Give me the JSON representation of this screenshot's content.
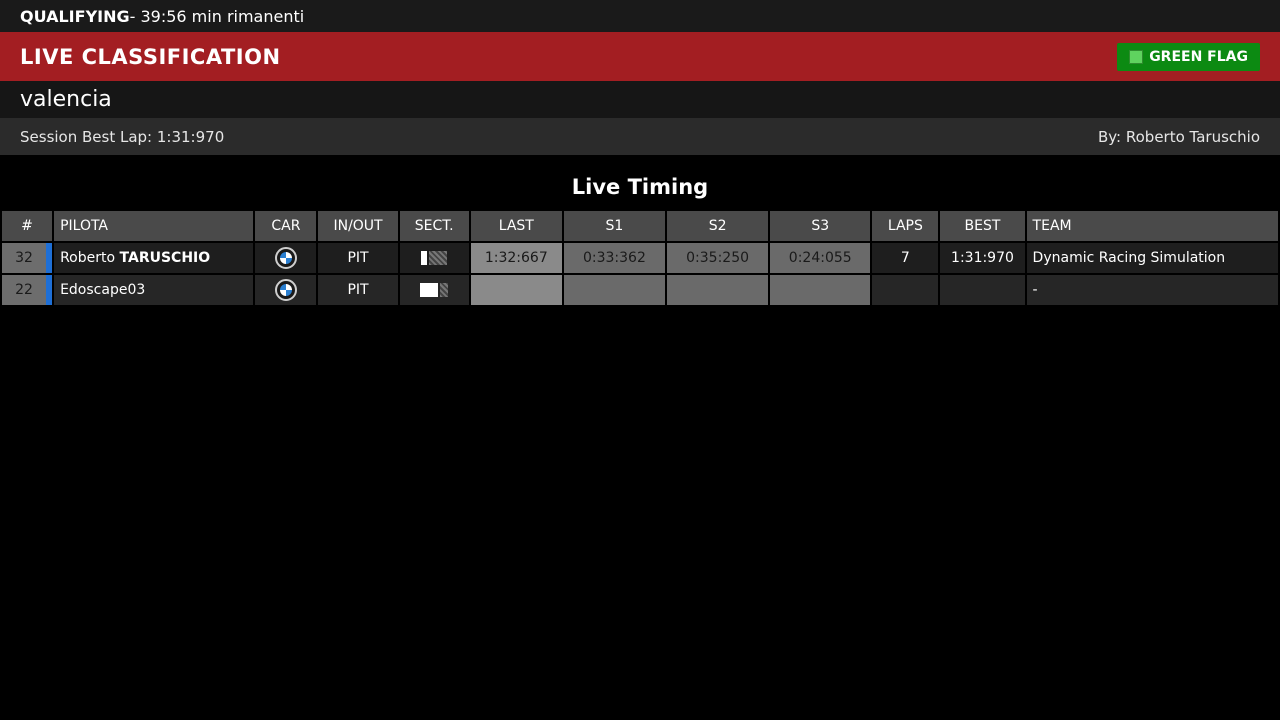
{
  "session": {
    "type": "QUALIFYING",
    "remaining": " - 39:56 min rimanenti"
  },
  "banner": {
    "title": "LIVE CLASSIFICATION",
    "flag_label": "GREEN FLAG",
    "flag_color": "#0c8a12"
  },
  "track": "valencia",
  "best": {
    "lap_text": "Session Best Lap: 1:31:970",
    "by_text": "By: Roberto Taruschio"
  },
  "section_title": "Live Timing",
  "table": {
    "headers": [
      "#",
      "PILOTA",
      "CAR",
      "IN/OUT",
      "SECT.",
      "LAST",
      "S1",
      "S2",
      "S3",
      "LAPS",
      "BEST",
      "TEAM"
    ],
    "rows": [
      {
        "num": "32",
        "first_name": "Roberto ",
        "last_name": "TARUSCHIO",
        "car_icon": "bmw-logo-icon",
        "inout": "PIT",
        "last": "1:32:667",
        "s1": "0:33:362",
        "s2": "0:35:250",
        "s3": "0:24:055",
        "laps": "7",
        "best": "1:31:970",
        "team": "Dynamic Racing Simulation"
      },
      {
        "num": "22",
        "first_name": "Edoscape03",
        "last_name": "",
        "car_icon": "bmw-logo-icon",
        "inout": "PIT",
        "last": "",
        "s1": "",
        "s2": "",
        "s3": "",
        "laps": "",
        "best": "",
        "team": "-"
      }
    ]
  },
  "colors": {
    "banner_red": "#a31e22",
    "driver_stripe": "#1e6fd6"
  }
}
